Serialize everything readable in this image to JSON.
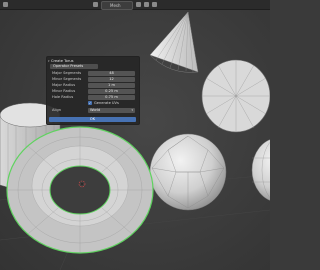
{
  "header": {
    "mode_label": "Mesh"
  },
  "panel": {
    "title": "Create Torus",
    "operator_label": "Operator Presets",
    "fields": [
      {
        "label": "Major Segments",
        "value": "48"
      },
      {
        "label": "Minor Segments",
        "value": "12"
      },
      {
        "label": "Major Radius",
        "value": "1 m"
      },
      {
        "label": "Minor Radius",
        "value": "0.25 m"
      },
      {
        "label": "Hole Radius",
        "value": "0.75 m"
      }
    ],
    "uv_label": "Generate UVs",
    "align_label": "Align",
    "align_value": "World",
    "ok_label": "OK"
  },
  "colors": {
    "selection_outline": "#5fd35f",
    "accent": "#4772b3"
  }
}
